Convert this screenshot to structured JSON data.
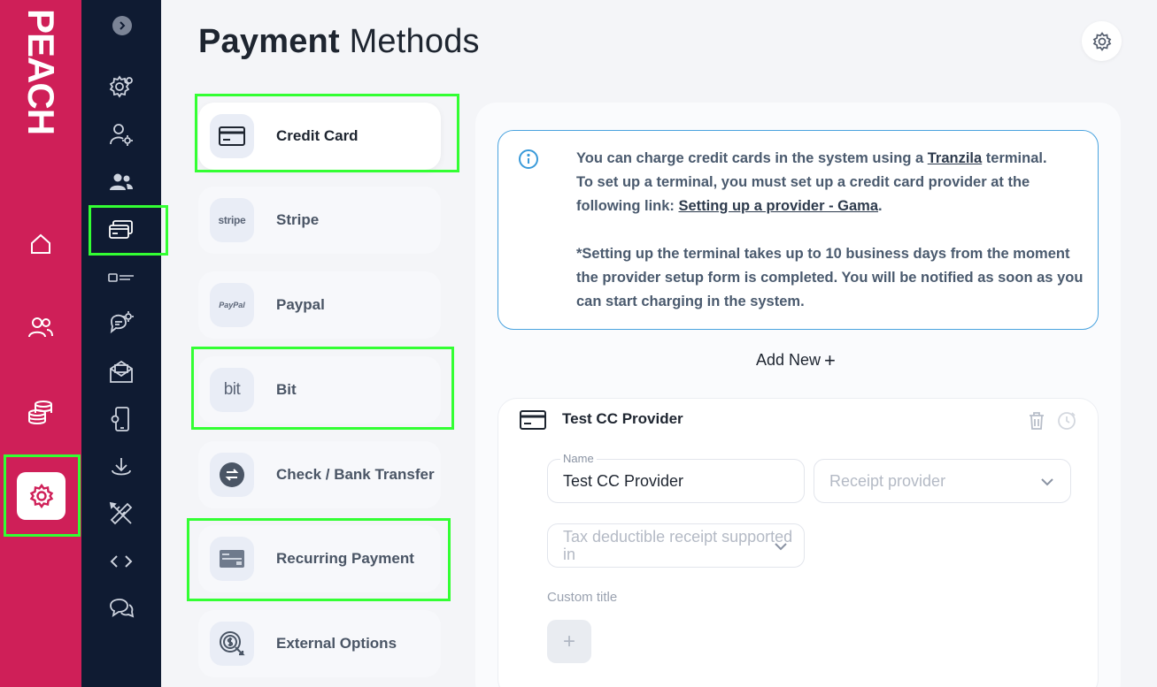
{
  "brand": {
    "logo_text": "PEACH"
  },
  "brand_nav": [
    {
      "name": "home",
      "icon": "home-icon"
    },
    {
      "name": "people",
      "icon": "users-icon"
    },
    {
      "name": "finance",
      "icon": "coins-icon"
    },
    {
      "name": "settings",
      "icon": "gear-icon",
      "active": true
    }
  ],
  "subnav": [
    {
      "icon": "cog-settings-icon"
    },
    {
      "icon": "user-settings-icon"
    },
    {
      "icon": "users-group-icon"
    },
    {
      "icon": "credit-cards-icon",
      "active": true
    },
    {
      "icon": "form-field-icon"
    },
    {
      "icon": "chat-settings-icon"
    },
    {
      "icon": "mail-icon"
    },
    {
      "icon": "mobile-icon"
    },
    {
      "icon": "download-icon"
    },
    {
      "icon": "design-tools-icon"
    },
    {
      "icon": "code-icon"
    },
    {
      "icon": "chat-bubbles-icon"
    }
  ],
  "header": {
    "title_bold": "Payment",
    "title_light": "Methods"
  },
  "methods": [
    {
      "label": "Credit Card",
      "icon": "credit-card-icon",
      "selected": true
    },
    {
      "label": "Stripe",
      "icon": "stripe-logo",
      "logo_text": "stripe"
    },
    {
      "label": "Paypal",
      "icon": "paypal-logo",
      "logo_text": "PayPal"
    },
    {
      "label": "Bit",
      "icon": "bit-logo",
      "logo_text": "bit"
    },
    {
      "label": "Check / Bank Transfer",
      "icon": "bank-transfer-icon"
    },
    {
      "label": "Recurring Payment",
      "icon": "recurring-card-icon"
    },
    {
      "label": "External Options",
      "icon": "external-dollar-icon"
    }
  ],
  "info": {
    "line1_pre": "You can charge credit cards in the system using a ",
    "line1_link": "Tranzila",
    "line1_post": " terminal.",
    "line2_pre": "To set up a terminal, you must set up a credit card provider at the following link: ",
    "line2_link": "Setting up a provider - Gama",
    "line2_post": ".",
    "note": "*Setting up the terminal takes up to 10 business days from the moment the provider setup form is completed. You will be notified as soon as you can start charging in the system."
  },
  "add_new": {
    "label": "Add New",
    "symbol": "+"
  },
  "provider": {
    "title": "Test CC Provider",
    "name_legend": "Name",
    "name_value": "Test CC Provider",
    "receipt_placeholder": "Receipt provider",
    "tax_placeholder": "Tax deductible receipt supported in",
    "custom_title_label": "Custom title",
    "plus_symbol": "+"
  },
  "colors": {
    "brand": "#cf1f58",
    "subnav": "#0f1b32",
    "accent": "#4aa3df",
    "highlight": "#33ff33"
  }
}
